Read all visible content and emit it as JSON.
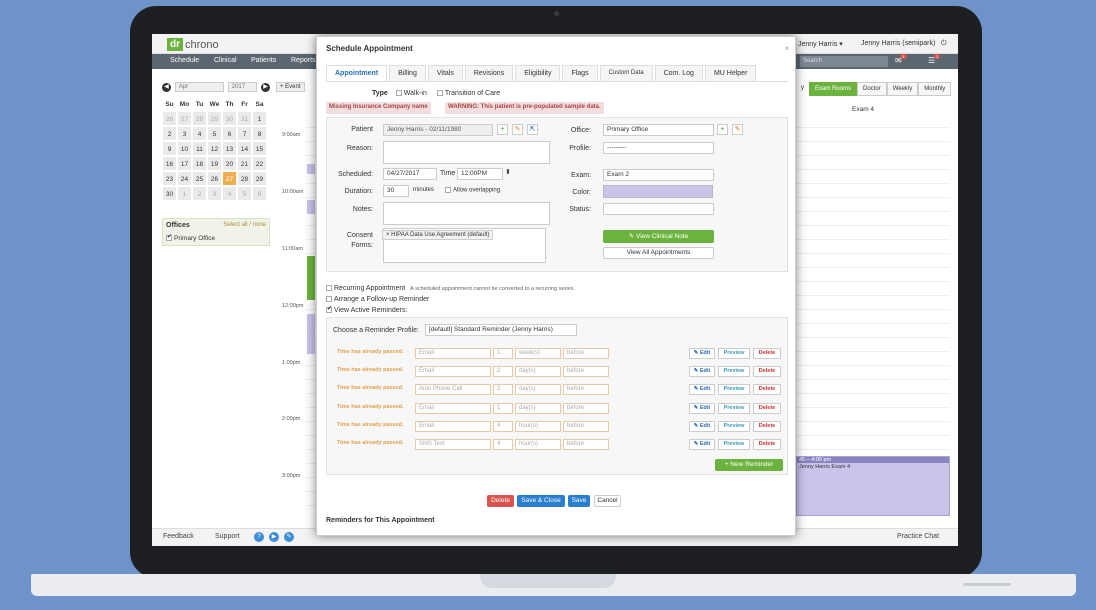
{
  "app": {
    "logo_dr": "dr",
    "logo_chrono": "chrono",
    "user_name": "Jenny Harris",
    "user_dropdown": "Jenny Harris",
    "user_practice": "Jenny Harris (semipark)",
    "search_placeholder": "Search",
    "mail_count": "1",
    "menu_count": "1"
  },
  "nav": [
    "Schedule",
    "Clinical",
    "Patients",
    "Reports"
  ],
  "calendar": {
    "month": "Apr",
    "year": "2017",
    "day_headers": [
      "Su",
      "Mo",
      "Tu",
      "We",
      "Th",
      "Fr",
      "Sa"
    ],
    "weeks": [
      [
        "26",
        "27",
        "28",
        "29",
        "30",
        "31",
        "1"
      ],
      [
        "2",
        "3",
        "4",
        "5",
        "6",
        "7",
        "8"
      ],
      [
        "9",
        "10",
        "11",
        "12",
        "13",
        "14",
        "15"
      ],
      [
        "16",
        "17",
        "18",
        "19",
        "20",
        "21",
        "22"
      ],
      [
        "23",
        "24",
        "25",
        "26",
        "27",
        "28",
        "29"
      ],
      [
        "30",
        "1",
        "2",
        "3",
        "4",
        "5",
        "6"
      ]
    ],
    "selected": "27"
  },
  "offices": {
    "title": "Offices",
    "select_links": "Select all / none",
    "item": "Primary Office"
  },
  "schedule": {
    "event_btn": "+ Event",
    "times": [
      "9:00am",
      "10:00am",
      "11:00am",
      "12:00pm",
      "1:00pm",
      "2:00pm",
      "3:00pm"
    ],
    "views": [
      "y",
      "Exam Rooms",
      "Doctor",
      "Weekly",
      "Monthly"
    ],
    "column": "Exam 4",
    "event_time": "45 – 4:00 pm",
    "event_text": "Jenny Harris Exam 4"
  },
  "footer": {
    "feedback": "Feedback",
    "support": "Support",
    "chat": "Practice Chat"
  },
  "modal": {
    "title": "Schedule Appointment",
    "close": "×",
    "tabs": [
      "Appointment",
      "Billing",
      "Vitals",
      "Revisions",
      "Eligibility",
      "Flags",
      "Custom Data",
      "Com. Log",
      "MU Helper"
    ],
    "type_label": "Type",
    "type_options": [
      "Walk-in",
      "Transition of Care"
    ],
    "alert1": "Missing Insurance Company name",
    "alert2": "WARNING: This patient is pre-populated sample data.",
    "patient_label": "Patient",
    "patient_value": "Jenny Harris - 02/11/1980",
    "reason_label": "Reason:",
    "scheduled_label": "Scheduled:",
    "date": "04/27/2017",
    "time_label": "Time",
    "time_value": "12:00PM",
    "duration_label": "Duration:",
    "duration_value": "30",
    "minutes": "minutes",
    "allow_overlap": "Allow overlapping",
    "notes_label": "Notes:",
    "consent_label": "Consent Forms:",
    "consent_tag": "× HIPAA Data Use Agreement (default)",
    "office_label": "Office:",
    "office_value": "Primary Office",
    "profile_label": "Profile:",
    "profile_value": "---------",
    "exam_label": "Exam:",
    "exam_value": "Exam 2",
    "color_label": "Color:",
    "status_label": "Status:",
    "view_note": "✎ View Clinical Note",
    "view_all": "View All Appointments",
    "recurring": "Recurring Appointment",
    "recurring_note": "A scheduled appointment cannot be converted to a recurring series.",
    "followup": "Arrange a Follow-up Reminder",
    "active_reminders": "View Active Reminders:",
    "reminder_profile_label": "Choose a Reminder Profile:",
    "reminder_profile_value": "[default] Standard Reminder (Jenny Harris)",
    "reminders": [
      {
        "warn": "Time has already passed.",
        "method": "Email",
        "num": "1",
        "unit": "week(s)",
        "when": "before"
      },
      {
        "warn": "Time has already passed.",
        "method": "Email",
        "num": "2",
        "unit": "day(s)",
        "when": "before"
      },
      {
        "warn": "Time has already passed.",
        "method": "Auto Phone Call",
        "num": "2",
        "unit": "day(s)",
        "when": "before"
      },
      {
        "warn": "Time has already passed.",
        "method": "Email",
        "num": "1",
        "unit": "day(s)",
        "when": "before"
      },
      {
        "warn": "Time has already passed.",
        "method": "Email",
        "num": "4",
        "unit": "hour(s)",
        "when": "before"
      },
      {
        "warn": "Time has already passed.",
        "method": "SMS Text",
        "num": "4",
        "unit": "hour(s)",
        "when": "before"
      }
    ],
    "edit": "✎ Edit",
    "preview": "Preview",
    "delete": "Delete",
    "new_reminder": "+ New Reminder",
    "btn_delete": "Delete",
    "btn_save_close": "Save & Close",
    "btn_save": "Save",
    "btn_cancel": "Cancel",
    "reminders_for": "Reminders for This Appointment"
  }
}
